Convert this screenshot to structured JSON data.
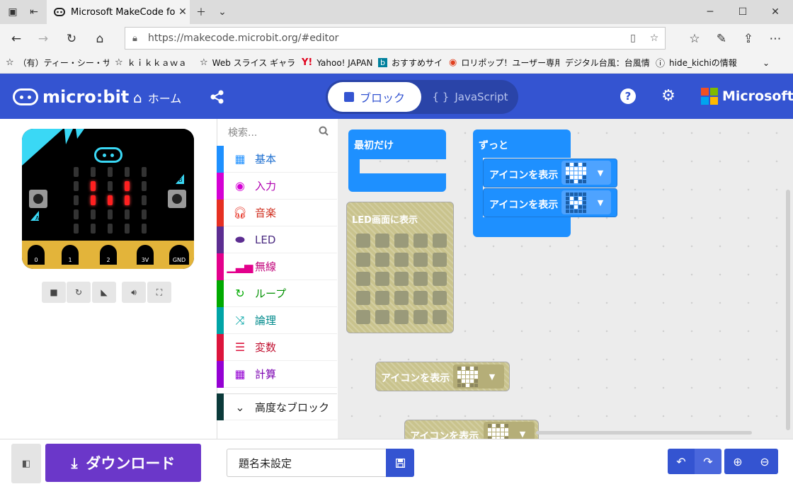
{
  "browser": {
    "tab_title": "Microsoft MakeCode fo",
    "url": "https://makecode.microbit.org/#editor",
    "favorites": [
      "（有）ティー・シー・サービ",
      "ｋｉｋｋａｗａ",
      "Web スライス ギャラリー",
      "Yahoo! JAPAN",
      "おすすめサイト",
      "ロリポップ！ユーザー専用",
      "デジタル台風：台風情報",
      "hide_kichiの情報"
    ]
  },
  "header": {
    "logo_text": "micro:bit",
    "home_label": "ホーム",
    "toggle_blocks": "ブロック",
    "toggle_js": "JavaScript",
    "brand": "Microsoft"
  },
  "simulator": {
    "pins": [
      "0",
      "1",
      "2",
      "3V",
      "GND"
    ],
    "button_a": "A",
    "button_b": "B",
    "lit_leds": [
      [
        1,
        1
      ],
      [
        3,
        1
      ],
      [
        1,
        2
      ],
      [
        2,
        2
      ],
      [
        3,
        2
      ]
    ]
  },
  "toolbox": {
    "search_placeholder": "検索...",
    "categories": [
      {
        "label": "基本",
        "color": "#1e90ff",
        "text_color": "#1e6fd0"
      },
      {
        "label": "入力",
        "color": "#d400d4",
        "text_color": "#b000b0"
      },
      {
        "label": "音楽",
        "color": "#e63022",
        "text_color": "#d03020"
      },
      {
        "label": "LED",
        "color": "#5c2d91",
        "text_color": "#4a2a80"
      },
      {
        "label": "無線",
        "color": "#e3008c",
        "text_color": "#c00078"
      },
      {
        "label": "ループ",
        "color": "#00aa00",
        "text_color": "#009000"
      },
      {
        "label": "論理",
        "color": "#00a4a6",
        "text_color": "#008a8c"
      },
      {
        "label": "変数",
        "color": "#dc143c",
        "text_color": "#c01030"
      },
      {
        "label": "計算",
        "color": "#9400d3",
        "text_color": "#7a00b0"
      }
    ],
    "advanced": "高度なブロック"
  },
  "workspace": {
    "on_start": "最初だけ",
    "forever": "ずっと",
    "show_icon": "アイコンを表示",
    "show_leds": "LED画面に表示"
  },
  "bottom": {
    "download": "ダウンロード",
    "project_name": "題名未設定"
  },
  "colors": {
    "header": "#3454d1",
    "download": "#6b37c9",
    "block": "#1e90ff"
  }
}
